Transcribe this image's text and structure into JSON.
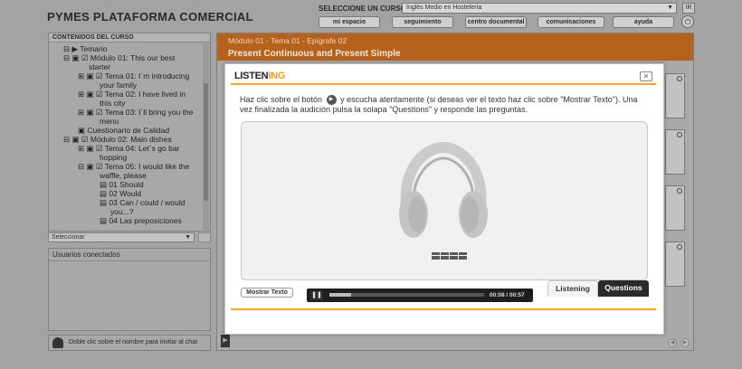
{
  "app": {
    "title": "PYMES PLATAFORMA COMERCIAL",
    "course_label": "SELECCIONE UN CURSO:",
    "course_value": "Inglés Medio en Hostelería",
    "go_label": "IR",
    "nav": [
      "mi espacio",
      "seguimiento",
      "centro documental",
      "comunicaciones",
      "ayuda"
    ]
  },
  "sidebar": {
    "header": "CONTENIDOS DEL CURSO",
    "tree": [
      {
        "text": "⊟ ▶ Temario"
      },
      {
        "text": "⊟ ▣ ☑ Módulo 01: This our best"
      },
      {
        "text": "starter"
      },
      {
        "text": "⊞ ▣ ☑ Tema 01: I´m introducing"
      },
      {
        "text": "your family"
      },
      {
        "text": "⊞ ▣ ☑ Tema 02: I have lived in"
      },
      {
        "text": "this city"
      },
      {
        "text": "⊞ ▣ ☑ Tema 03: I´ll bring you the"
      },
      {
        "text": "menu"
      },
      {
        "text": "▣ Cuestionario de Calidad"
      },
      {
        "text": "⊟ ▣ ☑ Módulo 02: Main dishes"
      },
      {
        "text": "⊞ ▣ ☑ Tema 04: Let´s go bar"
      },
      {
        "text": "hopping"
      },
      {
        "text": "⊟ ▣ ☑ Tema 05: I would like the"
      },
      {
        "text": "waffle, please"
      },
      {
        "text": "▤ 01 Should"
      },
      {
        "text": "▤ 02 Would"
      },
      {
        "text": "▤ 03 Can / could / would"
      },
      {
        "text": "you...?"
      },
      {
        "text": "▤ 04 Las preposiciones"
      }
    ],
    "select_label": "Seleccionar",
    "users_header": "Usuarios conectados",
    "chat_hint": "Doble clic sobre el nombre para invitar al chat"
  },
  "main": {
    "breadcrumb": "Módulo 01 - Tema 01 - Epígrafe 02",
    "lesson_title": "Present Continuous and Present Simple"
  },
  "modal": {
    "logo_a": "LISTEN",
    "logo_b": "ING",
    "close": "×",
    "instructions_before": "Haz clic sobre el botón",
    "instructions_after": "y escucha atentamente (si deseas ver el texto haz clic sobre \"Mostrar Texto\"). Una vez finalizada la audición pulsa la solapa \"Questions\" y responde las preguntas.",
    "show_text_label": "Mostrar Texto",
    "tabs": [
      "Listening",
      "Questions"
    ],
    "audio": {
      "pause_glyph": "❚❚",
      "time": "00:08 / 00:57",
      "progress": 0.14
    },
    "accent_color": "#f5a623"
  }
}
